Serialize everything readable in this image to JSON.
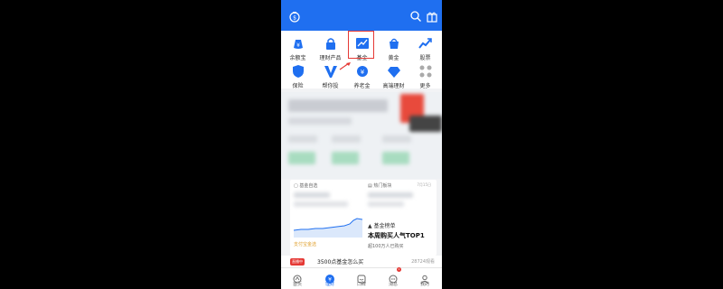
{
  "colors": {
    "primary": "#1f6ff0",
    "highlight": "#e53935",
    "gold": "#e0a230"
  },
  "header": {
    "icons": [
      "money-bag-icon",
      "search-icon",
      "gift-icon"
    ]
  },
  "grid": {
    "items": [
      {
        "label": "余额宝",
        "icon": "money-bag-icon"
      },
      {
        "label": "理财产品",
        "icon": "lock-icon"
      },
      {
        "label": "基金",
        "icon": "trend-chart-icon"
      },
      {
        "label": "黄金",
        "icon": "gold-bag-icon"
      },
      {
        "label": "股票",
        "icon": "stock-chart-icon"
      },
      {
        "label": "保险",
        "icon": "shield-icon"
      },
      {
        "label": "帮你投",
        "icon": "v-icon"
      },
      {
        "label": "养老金",
        "icon": "pension-icon"
      },
      {
        "label": "高端理财",
        "icon": "diamond-icon"
      },
      {
        "label": "更多",
        "icon": "more-grid-icon"
      }
    ]
  },
  "fund_cards": {
    "left": {
      "title": "基金自选",
      "caption": "支付宝金选"
    },
    "right": {
      "title": "热门板块",
      "meta": "7月15日",
      "rank_label": "基金榜单",
      "rank_head": "本周购买人气TOP1",
      "rank_sub": "超100万人已购买"
    }
  },
  "news": {
    "tag": "直播中",
    "text": "3500点基金怎么买",
    "count": "28724观看"
  },
  "tabbar": {
    "tabs": [
      {
        "label": "首页",
        "icon": "home-icon",
        "active": false
      },
      {
        "label": "理财",
        "icon": "wealth-icon",
        "active": true
      },
      {
        "label": "口碑",
        "icon": "koubei-icon",
        "active": false
      },
      {
        "label": "消息",
        "icon": "message-icon",
        "active": false,
        "badge": "1"
      },
      {
        "label": "我的",
        "icon": "user-icon",
        "active": false
      }
    ]
  }
}
